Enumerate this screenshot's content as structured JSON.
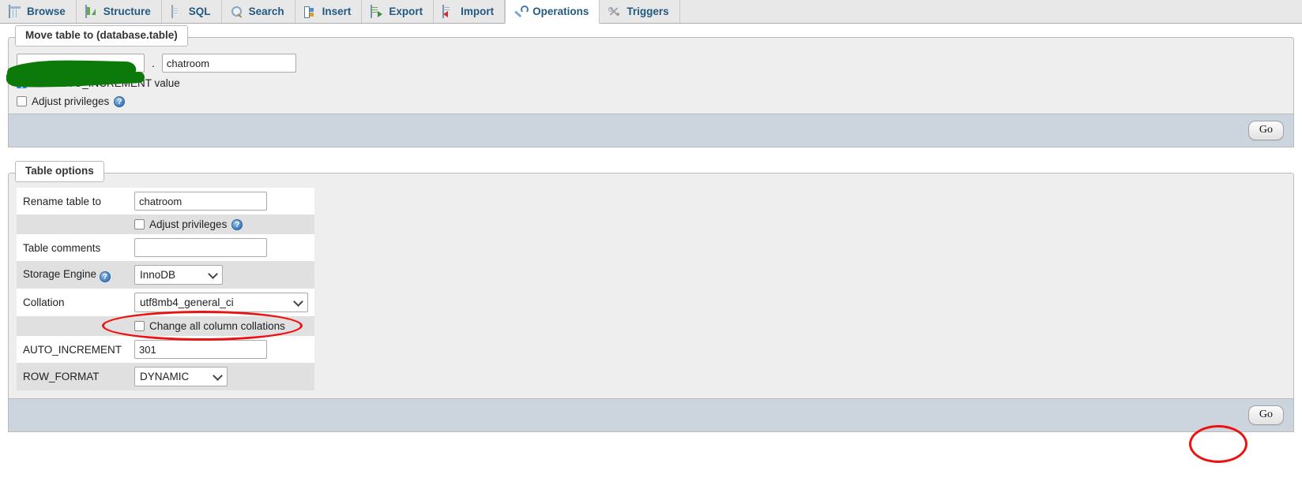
{
  "tabs": [
    {
      "label": "Browse",
      "icon": "browse-grid-icon",
      "active": false
    },
    {
      "label": "Structure",
      "icon": "structure-icon",
      "active": false
    },
    {
      "label": "SQL",
      "icon": "sql-page-icon",
      "active": false
    },
    {
      "label": "Search",
      "icon": "search-magnifier-icon",
      "active": false
    },
    {
      "label": "Insert",
      "icon": "insert-icon",
      "active": false
    },
    {
      "label": "Export",
      "icon": "export-icon",
      "active": false
    },
    {
      "label": "Import",
      "icon": "import-icon",
      "active": false
    },
    {
      "label": "Operations",
      "icon": "operations-wrench-icon",
      "active": true
    },
    {
      "label": "Triggers",
      "icon": "triggers-icon",
      "active": false
    }
  ],
  "move_table": {
    "legend": "Move table to (database.table)",
    "database_value": "",
    "database_placeholder": "",
    "separator": ".",
    "table_value": "chatroom",
    "redacted": true,
    "redaction_color": "#0b7a0b",
    "auto_increment_label": "Add AUTO_INCREMENT value",
    "auto_increment_checked": true,
    "adjust_privileges_label": "Adjust privileges",
    "adjust_privileges_checked": false,
    "help_glyph": "?",
    "go_label": "Go"
  },
  "table_options": {
    "legend": "Table options",
    "rows": [
      {
        "label": "Rename table to",
        "type": "text",
        "value": "chatroom"
      },
      {
        "label": "",
        "type": "checkbox",
        "value": "Adjust privileges",
        "checked": false,
        "help": true
      },
      {
        "label": "Table comments",
        "type": "text",
        "value": ""
      },
      {
        "label": "Storage Engine",
        "type": "select",
        "value": "InnoDB",
        "help": true
      },
      {
        "label": "Collation",
        "type": "select",
        "value": "utf8mb4_general_ci",
        "highlighted": true
      },
      {
        "label": "",
        "type": "checkbox",
        "value": "Change all column collations",
        "checked": false
      },
      {
        "label": "AUTO_INCREMENT",
        "type": "text",
        "value": "301"
      },
      {
        "label": "ROW_FORMAT",
        "type": "select",
        "value": "DYNAMIC"
      }
    ],
    "go_label": "Go"
  },
  "annotations": {
    "color": "#ee1111",
    "items": [
      {
        "name": "collation-highlight-ellipse",
        "shape": "ellipse"
      },
      {
        "name": "go-button-highlight-ellipse",
        "shape": "ellipse"
      }
    ]
  }
}
